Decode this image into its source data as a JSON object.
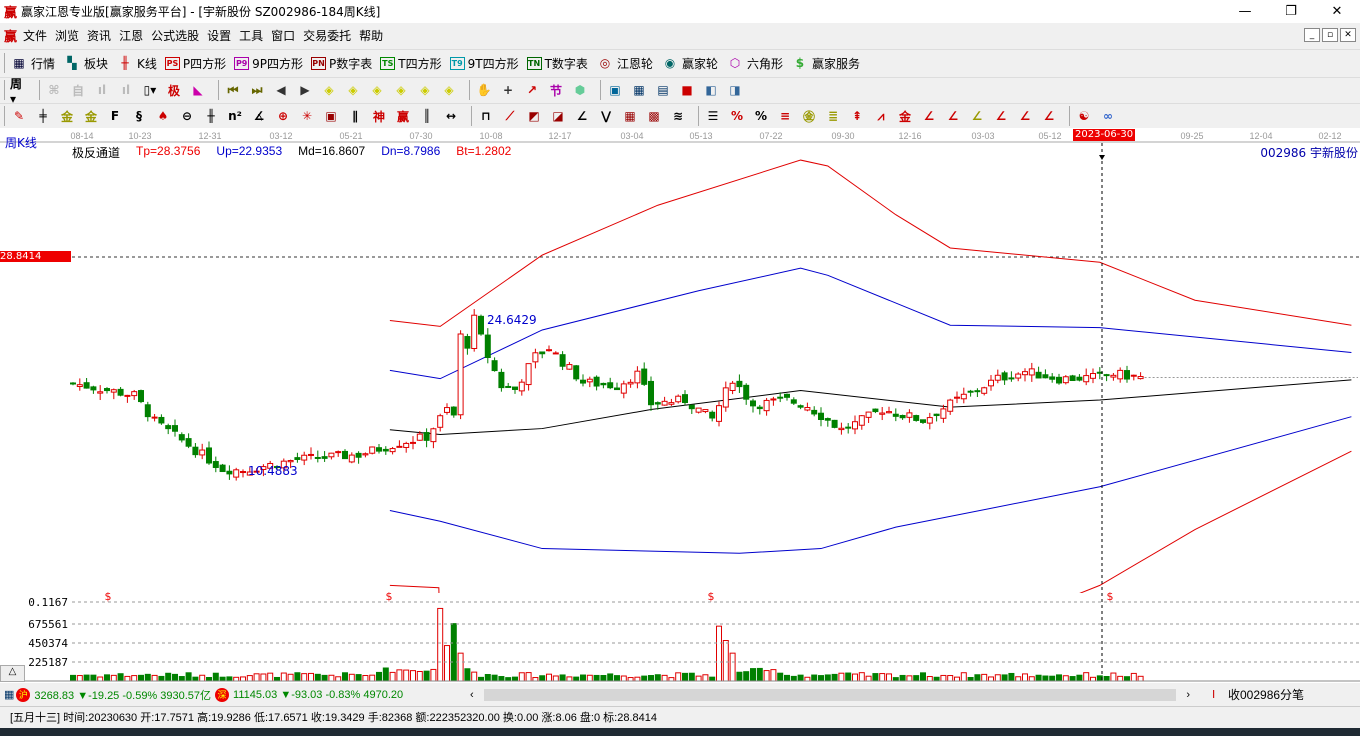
{
  "window": {
    "logo": "赢",
    "title": "赢家江恩专业版[赢家服务平台] - [宇新股份   SZ002986-184周K线]",
    "minimize": "—",
    "maximize": "❐",
    "close": "✕"
  },
  "menu": {
    "logo": "赢",
    "items": [
      "文件",
      "浏览",
      "资讯",
      "江恩",
      "公式选股",
      "设置",
      "工具",
      "窗口",
      "交易委托",
      "帮助"
    ],
    "mdi": [
      "_",
      "▫",
      "✕"
    ]
  },
  "toolbar1": [
    {
      "icon": "table-icon",
      "glyph": "▦",
      "color": "#003",
      "label": "行情"
    },
    {
      "icon": "blocks-icon",
      "glyph": "▚",
      "color": "#066",
      "label": "板块"
    },
    {
      "icon": "kline-icon",
      "glyph": "╫",
      "color": "#c00",
      "label": "K线"
    },
    {
      "icon": "ps-icon",
      "glyph": "PS",
      "color": "#c00",
      "box": true,
      "label": "P四方形"
    },
    {
      "icon": "p9-icon",
      "glyph": "P9",
      "color": "#a0a",
      "box": true,
      "label": "9P四方形"
    },
    {
      "icon": "pn-icon",
      "glyph": "PN",
      "color": "#900",
      "box": true,
      "label": "P数字表"
    },
    {
      "icon": "ts-icon",
      "glyph": "TS",
      "color": "#080",
      "box": true,
      "label": "T四方形"
    },
    {
      "icon": "t9-icon",
      "glyph": "T9",
      "color": "#09a",
      "box": true,
      "label": "9T四方形"
    },
    {
      "icon": "tn-icon",
      "glyph": "TN",
      "color": "#060",
      "box": true,
      "label": "T数字表"
    },
    {
      "icon": "gann-wheel-icon",
      "glyph": "◎",
      "color": "#900",
      "label": "江恩轮"
    },
    {
      "icon": "winner-wheel-icon",
      "glyph": "◉",
      "color": "#066",
      "label": "赢家轮"
    },
    {
      "icon": "hexagon-icon",
      "glyph": "⬡",
      "color": "#a0a",
      "label": "六角形"
    },
    {
      "icon": "dollar-icon",
      "glyph": "$",
      "color": "#3a3",
      "label": "赢家服务"
    }
  ],
  "toolbar2": [
    {
      "icon": "period-week-icon",
      "glyph": "周▾",
      "color": "#000"
    },
    {
      "icon": "sep"
    },
    {
      "icon": "weight-icon",
      "glyph": "⌘",
      "color": "#bbb"
    },
    {
      "icon": "self-icon",
      "glyph": "自",
      "color": "#bbb"
    },
    {
      "icon": "bar3-icon",
      "glyph": "ıl",
      "color": "#bbb"
    },
    {
      "icon": "bar9-icon",
      "glyph": "ıl",
      "color": "#bbb"
    },
    {
      "icon": "candle-type-icon",
      "glyph": "▯▾",
      "color": "#000"
    },
    {
      "icon": "extreme-icon",
      "glyph": "极",
      "color": "#c00"
    },
    {
      "icon": "volume-profile-icon",
      "glyph": "◣",
      "color": "#c0a"
    },
    {
      "icon": "sep"
    },
    {
      "icon": "first-icon",
      "glyph": "⏮",
      "color": "#660"
    },
    {
      "icon": "last-icon",
      "glyph": "⏭",
      "color": "#660"
    },
    {
      "icon": "prev-icon",
      "glyph": "◀",
      "color": "#333"
    },
    {
      "icon": "next-icon",
      "glyph": "▶",
      "color": "#333"
    },
    {
      "icon": "left-icon",
      "glyph": "◈",
      "color": "#cc0"
    },
    {
      "icon": "right-icon",
      "glyph": "◈",
      "color": "#cc0"
    },
    {
      "icon": "expand-icon",
      "glyph": "◈",
      "color": "#cc0"
    },
    {
      "icon": "shrink-icon",
      "glyph": "◈",
      "color": "#cc0"
    },
    {
      "icon": "zoom-in-icon",
      "glyph": "◈",
      "color": "#cc0"
    },
    {
      "icon": "zoom-out-icon",
      "glyph": "◈",
      "color": "#cc0"
    },
    {
      "icon": "sep"
    },
    {
      "icon": "hand-icon",
      "glyph": "✋",
      "color": "#333"
    },
    {
      "icon": "crosshair-icon",
      "glyph": "+",
      "color": "#333"
    },
    {
      "icon": "line-icon",
      "glyph": "↗",
      "color": "#c00"
    },
    {
      "icon": "jie-icon",
      "glyph": "节",
      "color": "#a0a"
    },
    {
      "icon": "hex-icon",
      "glyph": "⬢",
      "color": "#6c9"
    },
    {
      "icon": "sep"
    },
    {
      "icon": "calendar-icon",
      "glyph": "▣",
      "color": "#069"
    },
    {
      "icon": "calculator-icon",
      "glyph": "▦",
      "color": "#036"
    },
    {
      "icon": "notes-icon",
      "glyph": "▤",
      "color": "#036"
    },
    {
      "icon": "save-icon",
      "glyph": "■",
      "color": "#c00"
    },
    {
      "icon": "network-icon",
      "glyph": "◧",
      "color": "#369"
    },
    {
      "icon": "print-icon",
      "glyph": "◨",
      "color": "#369"
    }
  ],
  "toolbar3": [
    {
      "icon": "pen-icon",
      "glyph": "✎",
      "color": "#c00"
    },
    {
      "icon": "grid-icon",
      "glyph": "╪",
      "color": "#000"
    },
    {
      "icon": "gold1-icon",
      "glyph": "金",
      "color": "#990"
    },
    {
      "icon": "gold2-icon",
      "glyph": "金",
      "color": "#990"
    },
    {
      "icon": "fib-icon",
      "glyph": "F",
      "color": "#000"
    },
    {
      "icon": "spiral-icon",
      "glyph": "§",
      "color": "#000"
    },
    {
      "icon": "marker-icon",
      "glyph": "♠",
      "color": "#c00"
    },
    {
      "icon": "circle-icon",
      "glyph": "⊖",
      "color": "#000"
    },
    {
      "icon": "lines-icon",
      "glyph": "╫",
      "color": "#000"
    },
    {
      "icon": "n2-icon",
      "glyph": "n²",
      "color": "#000"
    },
    {
      "icon": "angle-icon",
      "glyph": "∡",
      "color": "#000"
    },
    {
      "icon": "target-icon",
      "glyph": "⊕",
      "color": "#c00"
    },
    {
      "icon": "star-icon",
      "glyph": "✳",
      "color": "#c00"
    },
    {
      "icon": "square-icon",
      "glyph": "▣",
      "color": "#900"
    },
    {
      "icon": "parallel-icon",
      "glyph": "∥",
      "color": "#000"
    },
    {
      "icon": "shen-icon",
      "glyph": "神",
      "color": "#c00"
    },
    {
      "icon": "ying-icon",
      "glyph": "赢",
      "color": "#c00"
    },
    {
      "icon": "cycle-icon",
      "glyph": "║",
      "color": "#000"
    },
    {
      "icon": "span-icon",
      "glyph": "↔",
      "color": "#000"
    },
    {
      "icon": "sep"
    },
    {
      "icon": "box-icon",
      "glyph": "⊓",
      "color": "#000"
    },
    {
      "icon": "fan-icon",
      "glyph": "⟋",
      "color": "#c00"
    },
    {
      "icon": "fan2-icon",
      "glyph": "◩",
      "color": "#900"
    },
    {
      "icon": "fan3-icon",
      "glyph": "◪",
      "color": "#900"
    },
    {
      "icon": "angle2-icon",
      "glyph": "∠",
      "color": "#000"
    },
    {
      "icon": "wave-icon",
      "glyph": "⋁",
      "color": "#000"
    },
    {
      "icon": "grid2-icon",
      "glyph": "▦",
      "color": "#900"
    },
    {
      "icon": "grid3-icon",
      "glyph": "▩",
      "color": "#900"
    },
    {
      "icon": "channel-icon",
      "glyph": "≋",
      "color": "#000"
    },
    {
      "icon": "sep"
    },
    {
      "icon": "table2-icon",
      "glyph": "☰",
      "color": "#000"
    },
    {
      "icon": "pct-line-icon",
      "glyph": "%",
      "color": "#c00"
    },
    {
      "icon": "pct-icon",
      "glyph": "%",
      "color": "#000"
    },
    {
      "icon": "pct-lines-icon",
      "glyph": "≡",
      "color": "#c00"
    },
    {
      "icon": "gold-circle-icon",
      "glyph": "㊎",
      "color": "#990"
    },
    {
      "icon": "gold-lines-icon",
      "glyph": "≣",
      "color": "#990"
    },
    {
      "icon": "arrow-icon",
      "glyph": "⇞",
      "color": "#c00"
    },
    {
      "icon": "peak-icon",
      "glyph": "⩘",
      "color": "#c00"
    },
    {
      "icon": "gold3-icon",
      "glyph": "金",
      "color": "#c00"
    },
    {
      "icon": "fan-j-icon",
      "glyph": "∠",
      "color": "#c00"
    },
    {
      "icon": "fan-f-icon",
      "glyph": "∠",
      "color": "#c00"
    },
    {
      "icon": "fan-gold-icon",
      "glyph": "∠",
      "color": "#990"
    },
    {
      "icon": "fan-shen-icon",
      "glyph": "∠",
      "color": "#c00"
    },
    {
      "icon": "fan-ying-icon",
      "glyph": "∠",
      "color": "#c00"
    },
    {
      "icon": "fan-four-icon",
      "glyph": "∠",
      "color": "#c00"
    },
    {
      "icon": "sep"
    },
    {
      "icon": "yinyang-icon",
      "glyph": "☯",
      "color": "#c00"
    },
    {
      "icon": "infinity-icon",
      "glyph": "∞",
      "color": "#36c"
    }
  ],
  "chart_header": {
    "period": "周K线",
    "indicator": "极反通道",
    "tp": "Tp=28.3756",
    "up": "Up=22.9353",
    "md": "Md=16.8607",
    "dn": "Dn=8.7986",
    "bt": "Bt=1.2802",
    "stock": "002986  宇新股份",
    "price_tag": "28.8414",
    "high_label": "24.6429",
    "low_label": "10.4883",
    "cursor_date": "2023-06-30"
  },
  "date_axis": [
    "08-14",
    "10-23",
    "12-31",
    "03-12",
    "05-21",
    "07-30",
    "10-08",
    "12-17",
    "03-04",
    "05-13",
    "07-22",
    "09-30",
    "12-16",
    "03-03",
    "05-12",
    "09-25",
    "12-04",
    "02-12"
  ],
  "volume_axis": [
    "0.1167",
    "675561",
    "450374",
    "225187"
  ],
  "volume_markers": [
    "$",
    "$",
    "$",
    "$"
  ],
  "colors": {
    "up": "#e00000",
    "down": "#008000",
    "upper_band": "#e00000",
    "mid_band": "#0000cc",
    "middle": "#000000"
  },
  "chart_data": {
    "type": "candlestick",
    "price_reference": 28.8414,
    "close_anchors": [
      [
        0,
        18.2
      ],
      [
        9,
        17.2
      ],
      [
        12,
        15.0
      ],
      [
        22,
        11.0
      ],
      [
        25,
        10.9
      ],
      [
        33,
        11.8
      ],
      [
        42,
        12.2
      ],
      [
        48,
        13.2
      ],
      [
        52,
        13.7
      ],
      [
        56,
        15.5
      ],
      [
        55,
        16.0
      ],
      [
        53,
        14.5
      ],
      [
        55.5,
        16.5
      ],
      [
        56.5,
        22.5
      ],
      [
        58,
        21.5
      ],
      [
        59,
        23.6
      ],
      [
        61,
        20.5
      ],
      [
        63,
        18.0
      ],
      [
        65,
        17.7
      ],
      [
        68,
        20.5
      ],
      [
        70,
        21.2
      ],
      [
        72,
        20.0
      ],
      [
        75,
        18.3
      ],
      [
        80,
        18.0
      ],
      [
        83,
        19.0
      ],
      [
        85,
        16.5
      ],
      [
        90,
        16.8
      ],
      [
        94,
        15.2
      ],
      [
        97,
        18.6
      ],
      [
        100,
        16.4
      ],
      [
        105,
        16.8
      ],
      [
        108,
        16.3
      ],
      [
        113,
        14.3
      ],
      [
        115,
        14.8
      ],
      [
        119,
        16.0
      ],
      [
        125,
        15.1
      ],
      [
        130,
        16.8
      ],
      [
        136,
        18.6
      ],
      [
        140,
        19.2
      ],
      [
        145,
        18.6
      ],
      [
        150,
        18.7
      ],
      [
        153,
        19.0
      ],
      [
        157,
        18.7
      ]
    ],
    "volume_spikes": [
      [
        54,
        860000
      ],
      [
        55,
        420000
      ],
      [
        56,
        680000
      ],
      [
        57,
        330000
      ],
      [
        95,
        650000
      ],
      [
        96,
        480000
      ],
      [
        97,
        330000
      ]
    ],
    "bands": {
      "top": [
        [
          46.6,
          23.5
        ],
        [
          54,
          23.0
        ],
        [
          69,
          29.0
        ],
        [
          86,
          33.2
        ],
        [
          107,
          37.0
        ],
        [
          111,
          36.5
        ],
        [
          121,
          32.4
        ],
        [
          129,
          29.6
        ],
        [
          151,
          28.4
        ],
        [
          165,
          25.2
        ],
        [
          188,
          23.1
        ]
      ],
      "upper": [
        [
          46.6,
          19.3
        ],
        [
          54,
          18.6
        ],
        [
          69,
          22.7
        ],
        [
          92,
          26.0
        ],
        [
          107,
          27.9
        ],
        [
          111,
          27.3
        ],
        [
          129,
          23.1
        ],
        [
          151,
          22.9
        ],
        [
          188,
          20.8
        ]
      ],
      "middle": [
        [
          46.6,
          14.3
        ],
        [
          54,
          13.9
        ],
        [
          69,
          14.4
        ],
        [
          85,
          16.0
        ],
        [
          107,
          17.6
        ],
        [
          129,
          16.2
        ],
        [
          151,
          16.8
        ],
        [
          188,
          18.5
        ]
      ],
      "lower": [
        [
          46.6,
          7.5
        ],
        [
          54,
          6.6
        ],
        [
          69,
          4.3
        ],
        [
          98,
          3.9
        ],
        [
          110,
          4.3
        ],
        [
          121,
          6.1
        ],
        [
          151,
          9.5
        ],
        [
          188,
          15.4
        ]
      ],
      "bottom": [
        [
          46.6,
          1.2
        ],
        [
          53.8,
          1.0
        ],
        [
          54,
          -5
        ],
        [
          144,
          -5
        ],
        [
          144.4,
          -0.3
        ],
        [
          151,
          1.2
        ],
        [
          165,
          5.9
        ],
        [
          188,
          12.5
        ]
      ]
    }
  },
  "status": {
    "sh_badge": "沪",
    "sh": "3268.83 ▼-19.25 -0.59% 3930.57亿",
    "sz_badge": "深",
    "sz": "11145.03 ▼-93.03 -0.83% 4970.20",
    "scroll_left": "‹",
    "scroll_right": "›",
    "ticks": "收002986分笔",
    "info": "[五月十三] 时间:20230630 开:17.7571 高:19.9286 低:17.6571 收:19.3429 手:82368 额:222352320.00 换:0.00 涨:8.06 盘:0 标:28.8414"
  }
}
